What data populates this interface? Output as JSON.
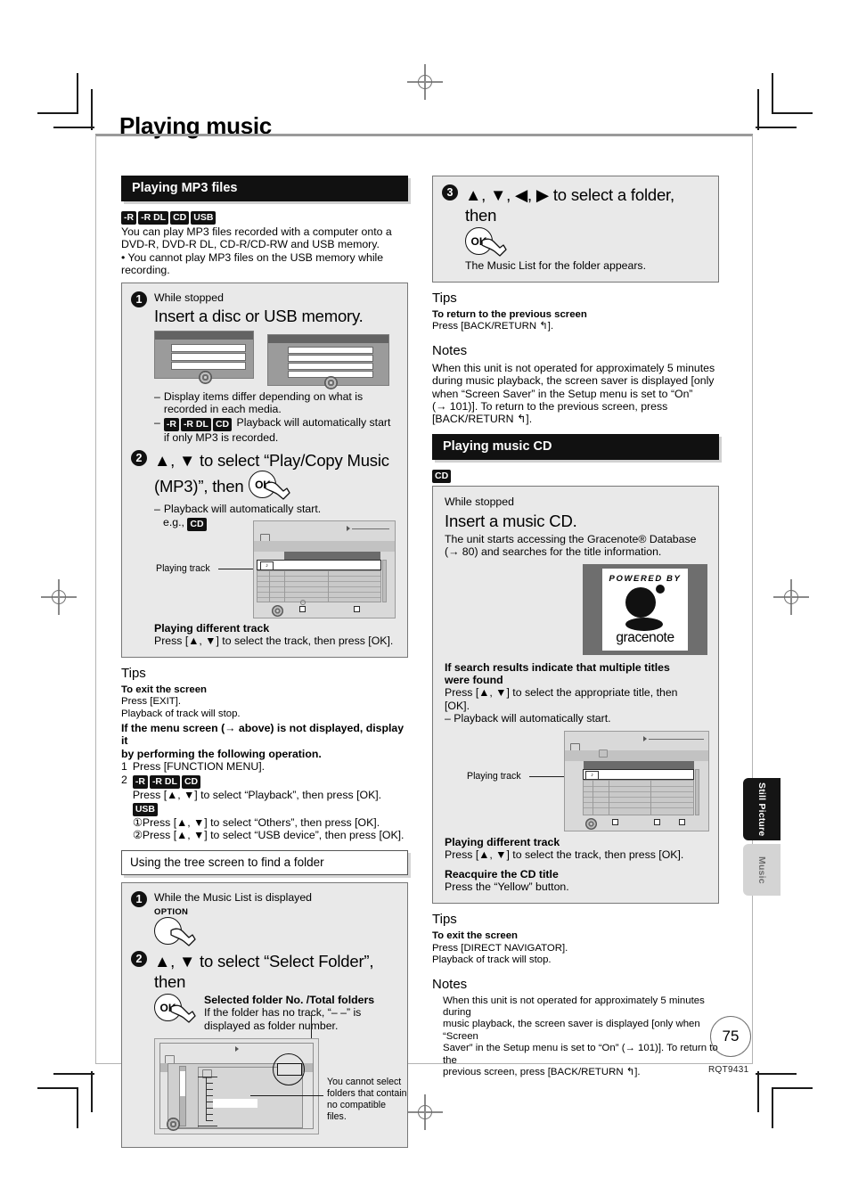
{
  "page": {
    "title": "Playing music",
    "number": "75",
    "doc_code": "RQT9431"
  },
  "side_tabs": [
    {
      "label": "Still Picture",
      "active": true
    },
    {
      "label": "Music",
      "active": false
    }
  ],
  "left": {
    "section_header": "Playing MP3 files",
    "badges": [
      "-R",
      "-R DL",
      "CD",
      "USB"
    ],
    "intro_line1": "You can play MP3 files recorded with a computer onto a",
    "intro_line2": "DVD-R, DVD-R DL, CD-R/CD-RW and USB memory.",
    "intro_bullet": "• You cannot play MP3 files on the USB memory while recording.",
    "step1": {
      "num": "1",
      "lead": "While stopped",
      "headline": "Insert a disc or USB memory.",
      "dash1": "Display items differ depending on what is recorded in each media.",
      "dash2_badges": [
        "-R",
        "-R DL",
        "CD"
      ],
      "dash2": "Playback will automatically start if only MP3 is recorded."
    },
    "step2": {
      "num": "2",
      "headline_a": "▲, ▼ to select “Play/Copy Music",
      "headline_b": "(MP3)”, then",
      "ok_label": "OK",
      "dash1": "Playback will automatically start.",
      "eg_label": "e.g.,",
      "eg_badge": "CD",
      "callout": "Playing track",
      "sub_title": "Playing different track",
      "sub_text": "Press [▲, ▼] to select the track, then press [OK]."
    },
    "tips": {
      "heading": "Tips",
      "b1": "To exit the screen",
      "l1": "Press [EXIT].",
      "l2": "Playback of track will stop.",
      "b2_line1": "If the menu screen (→ above) is not displayed, display it",
      "b2_line2": "by performing the following operation.",
      "n1": "1",
      "n1_text": "Press [FUNCTION MENU].",
      "n2": "2",
      "n2_badges": [
        "-R",
        "-R DL",
        "CD"
      ],
      "n2_text": "Press [▲, ▼] to select “Playback”, then press [OK].",
      "usb_badge": "USB",
      "usb_1": "①Press [▲, ▼] to select “Others”, then press [OK].",
      "usb_2": "②Press [▲, ▼] to select “USB device”, then press [OK]."
    },
    "tree": {
      "subhead": "Using the tree screen to find a folder",
      "step1": {
        "num": "1",
        "lead": "While the Music List is displayed",
        "option_label": "OPTION"
      },
      "step2": {
        "num": "2",
        "headline": "▲, ▼ to select “Select Folder”, then",
        "ok_label": "OK",
        "note_title": "Selected folder No. /Total folders",
        "note_l1": "If the folder has no track, “– –” is",
        "note_l2": "displayed as folder number.",
        "callout_l1": "You cannot select",
        "callout_l2": "folders that contain",
        "callout_l3": "no compatible files."
      }
    }
  },
  "right": {
    "step3": {
      "num": "3",
      "headline": "▲, ▼, ◀, ▶ to select a folder, then",
      "ok_label": "OK",
      "after": "The Music List for the folder appears."
    },
    "tips": {
      "heading": "Tips",
      "b1": "To return to the previous screen",
      "l1": "Press [BACK/RETURN ↰]."
    },
    "notes": {
      "heading": "Notes",
      "l1": "When this unit is not operated for approximately 5 minutes",
      "l2": "during music playback, the screen saver is displayed [only",
      "l3": "when “Screen Saver” in the Setup menu is set to “On”",
      "l4": "(→ 101)]. To return to the previous screen, press",
      "l5": "[BACK/RETURN ↰]."
    },
    "section_header": "Playing music CD",
    "badge": "CD",
    "cd": {
      "lead": "While stopped",
      "headline": "Insert a music CD.",
      "t1": "The unit starts accessing the Gracenote® Database",
      "t2": "(→ 80) and searches for the title information.",
      "gracenote_powered": "POWERED BY",
      "gracenote_word": "gracenote",
      "m1": "If search results indicate that multiple titles",
      "m2": "were found",
      "m3": "Press [▲, ▼] to select the appropriate title, then",
      "m4": "[OK].",
      "m5": "– Playback will automatically start.",
      "callout": "Playing track",
      "sub1_title": "Playing different track",
      "sub1_text": "Press [▲, ▼] to select the track, then press [OK].",
      "sub2_title": "Reacquire the CD title",
      "sub2_text": "Press the “Yellow” button."
    },
    "tips2": {
      "heading": "Tips",
      "b1": "To exit the screen",
      "l1": "Press [DIRECT NAVIGATOR].",
      "l2": "Playback of track will stop."
    },
    "notes2": {
      "heading": "Notes",
      "l1": "When this unit is not operated for approximately 5 minutes during",
      "l2": "music playback, the screen saver is displayed [only when “Screen",
      "l3": "Saver” in the Setup menu is set to “On” (→ 101)]. To return to the",
      "l4": "previous screen, press [BACK/RETURN ↰]."
    }
  }
}
